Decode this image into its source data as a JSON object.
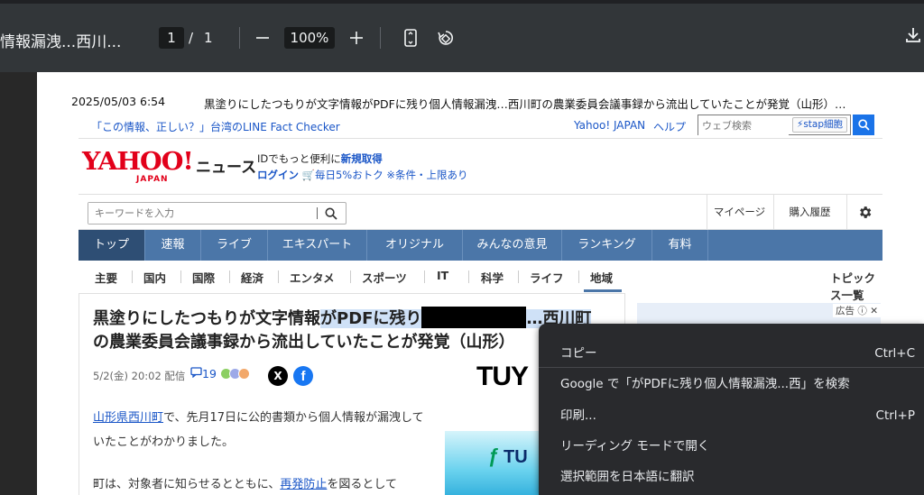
{
  "toolbar": {
    "doc_title": "情報漏洩...西川...",
    "page_current": "1",
    "page_sep": "/",
    "page_total": "1",
    "zoom": "100%",
    "zoom_out_icon": "minus-icon",
    "zoom_in_icon": "plus-icon",
    "fit_icon": "fit-to-page-icon",
    "rotate_icon": "rotate-icon",
    "download_icon": "download-icon"
  },
  "pdf": {
    "header_date": "2025/05/03 6:54",
    "header_title": "黒塗りにしたつもりが文字情報がPDFに残り個人情報漏洩…西川町の農業委員会議事録から流出していたことが発覚（山形）…",
    "factbar": {
      "fact_link": "「この情報、正しい？」台湾のLINE Fact Checker",
      "yahoo_link": "Yahoo! JAPAN",
      "help_link": "ヘルプ",
      "search_placeholder": "ウェブ検索",
      "stap_button": "stap細胞"
    },
    "brand": {
      "logo_main": "YAHOO!",
      "logo_sub": "JAPAN",
      "news_label": "ニュース",
      "promo_line1_pre": "IDでもっと便利に",
      "promo_line1_link": "新規取得",
      "login": "ログイン",
      "promo_line2": "毎日5%おトク ※条件・上限あり"
    },
    "search": {
      "placeholder": "キーワードを入力",
      "my_page": "マイページ",
      "purchase_history": "購入履歴"
    },
    "nav": [
      "トップ",
      "速報",
      "ライブ",
      "エキスパート",
      "オリジナル",
      "みんなの意見",
      "ランキング",
      "有料"
    ],
    "categories": [
      "主要",
      "国内",
      "国際",
      "経済",
      "エンタメ",
      "スポーツ",
      "IT",
      "科学",
      "ライフ",
      "地域"
    ],
    "topic_list": "トピックス一覧",
    "article": {
      "title_a": "黒塗りにしたつもりが文字情報",
      "title_b": "がPDFに残り",
      "title_c": "…西川町",
      "title_line2": "の農業委員会議事録から流出していたことが発覚（山形）",
      "meta": "5/2(金) 20:02 配信",
      "comments": "19",
      "share_x": "X",
      "share_fb": "f",
      "source_logo": "TUY",
      "body_link1": "山形県西川町",
      "body_text1": "で、先月17日に公的書類から個人情報が漏洩していたことがわかりました。",
      "body_text2_pre": "町は、対象者に知らせるとともに、",
      "body_link2": "再発防止",
      "body_text2_post": "を図るとして",
      "image_text": "TU"
    },
    "ad_label": "広告"
  },
  "context_menu": {
    "items": [
      {
        "label": "コピー",
        "shortcut": "Ctrl+C"
      },
      {
        "label": "Google で「がPDFに残り個人情報漏洩...西」を検索",
        "shortcut": ""
      },
      {
        "label": "印刷...",
        "shortcut": "Ctrl+P"
      },
      {
        "label": "リーディング モードで開く",
        "shortcut": ""
      },
      {
        "label": "選択範囲を日本語に翻訳",
        "shortcut": ""
      }
    ]
  },
  "colors": {
    "toolbar_bg": "#323639",
    "viewer_bg": "#282828",
    "nav_bg": "#4b76a8",
    "nav_active": "#2e4e74",
    "link": "#1a56c7",
    "yahoo_red": "#e2001a",
    "selection": "#cfe1f7",
    "menu_bg": "#292a2d"
  }
}
